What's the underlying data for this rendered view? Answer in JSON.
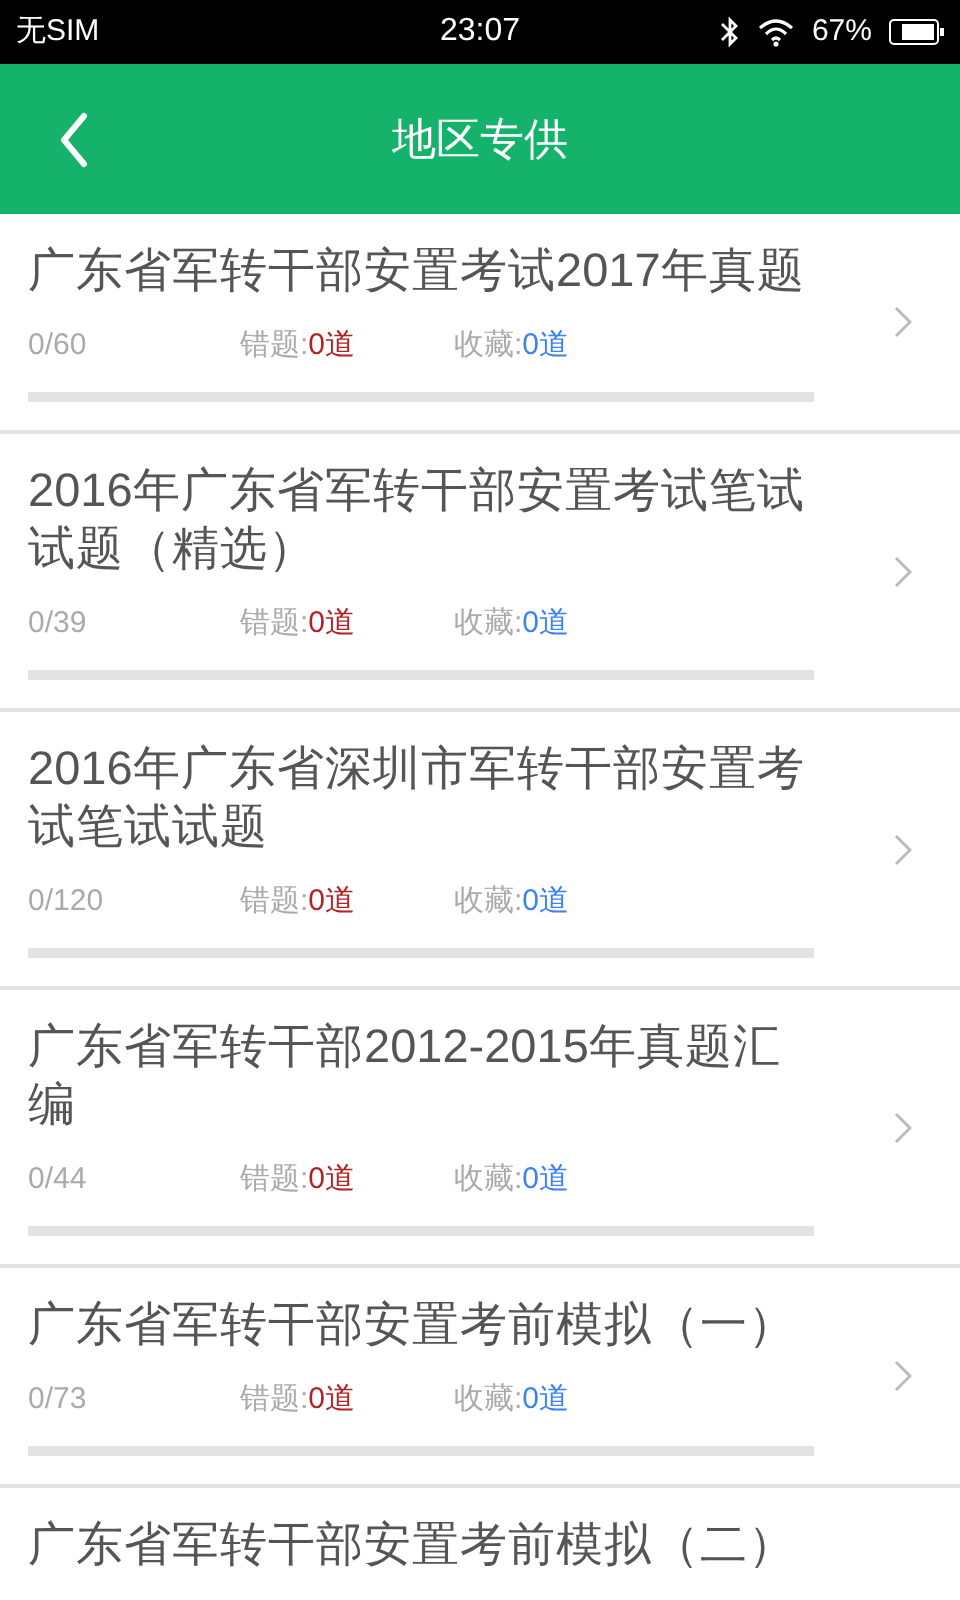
{
  "status_bar": {
    "carrier": "无SIM",
    "time": "23:07",
    "battery": "67%"
  },
  "header": {
    "title": "地区专供"
  },
  "items": [
    {
      "title": "广东省军转干部安置考试2017年真题",
      "progress": "0/60",
      "level": 0,
      "wrong_label": "错题:",
      "wrong_count": "0道",
      "fav_label": "收藏:",
      "fav_count": "0道"
    },
    {
      "title": "2016年广东省军转干部安置考试笔试试题（精选）",
      "progress": "0/39",
      "level": 0,
      "wrong_label": "错题:",
      "wrong_count": "0道",
      "fav_label": "收藏:",
      "fav_count": "0道"
    },
    {
      "title": "2016年广东省深圳市军转干部安置考试笔试试题",
      "progress": "0/120",
      "level": 0,
      "wrong_label": "错题:",
      "wrong_count": "0道",
      "fav_label": "收藏:",
      "fav_count": "0道"
    },
    {
      "title": "广东省军转干部2012-2015年真题汇编",
      "progress": "0/44",
      "level": 0,
      "wrong_label": "错题:",
      "wrong_count": "0道",
      "fav_label": "收藏:",
      "fav_count": "0道"
    },
    {
      "title": "广东省军转干部安置考前模拟（一）",
      "progress": "0/73",
      "level": 0,
      "wrong_label": "错题:",
      "wrong_count": "0道",
      "fav_label": "收藏:",
      "fav_count": "0道"
    },
    {
      "title": "广东省军转干部安置考前模拟（二）"
    }
  ]
}
